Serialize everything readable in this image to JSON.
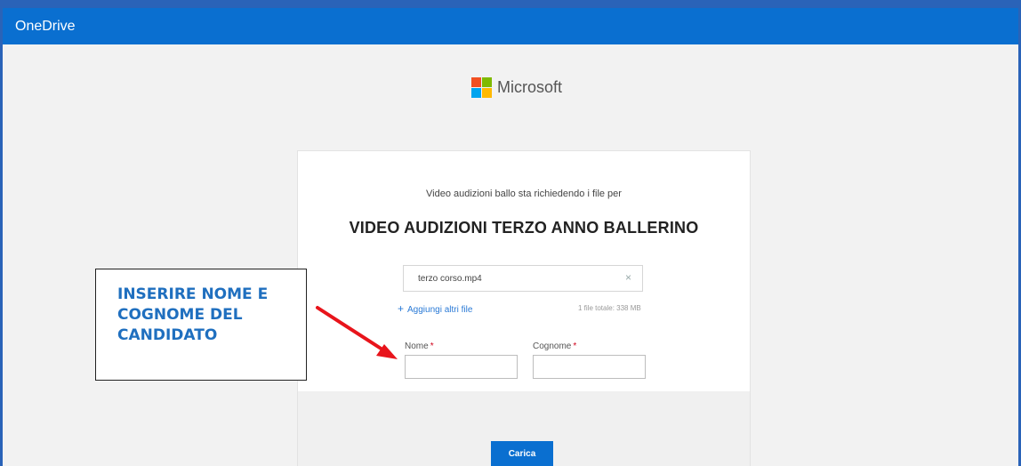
{
  "app": {
    "title": "OneDrive"
  },
  "brand": {
    "name": "Microsoft",
    "logo_colors": [
      "#f25022",
      "#7fba00",
      "#00a4ef",
      "#ffb900"
    ]
  },
  "form": {
    "request_text": "Video audizioni ballo sta richiedendo i file per",
    "event_title": "VIDEO AUDIZIONI TERZO ANNO BALLERINO",
    "file": {
      "name": "terzo corso.mp4",
      "remove_icon": "×"
    },
    "add_files_label": "Aggiungi altri file",
    "add_files_icon": "+",
    "file_total": "1 file totale: 338 MB",
    "fields": {
      "first_name": {
        "label": "Nome",
        "required_mark": "*",
        "value": ""
      },
      "last_name": {
        "label": "Cognome",
        "required_mark": "*",
        "value": ""
      }
    },
    "upload_button": "Carica"
  },
  "annotation": {
    "text": "INSERIRE NOME E COGNOME DEL CANDIDATO",
    "text_color": "#1f6fbf",
    "arrow_color": "#e8141b"
  },
  "colors": {
    "accent": "#0a6fd0",
    "required": "#d0021b"
  }
}
